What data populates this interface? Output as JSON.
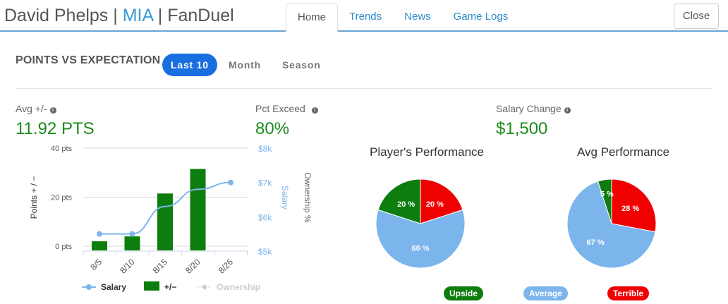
{
  "header": {
    "player": "David Phelps",
    "sep": "|",
    "team": "MIA",
    "site": "FanDuel",
    "tabs": [
      "Home",
      "Trends",
      "News",
      "Game Logs"
    ],
    "close_label": "Close"
  },
  "section": {
    "title": "POINTS VS EXPECTATION",
    "ranges": [
      "Last 10",
      "Month",
      "Season"
    ],
    "active_range": "Last 10"
  },
  "stats": {
    "avg_label": "Avg +/-",
    "avg_value": "11.92 PTS",
    "pct_label": "Pct Exceed",
    "pct_value": "80%",
    "salary_label": "Salary Change",
    "salary_value": "$1,500"
  },
  "colors": {
    "green": "#1e8a1e",
    "bar": "#0d7d0d",
    "salary": "#7cb5ec",
    "red": "#f00000",
    "accent": "#1a6fe0"
  },
  "chart_data": [
    {
      "type": "bar",
      "categories": [
        "8/5",
        "8/10",
        "8/15",
        "8/20",
        "8/26"
      ],
      "series": [
        {
          "name": "+/−",
          "type": "bar",
          "values": [
            2,
            4,
            21.5,
            31.5,
            null
          ]
        },
        {
          "name": "Salary",
          "type": "line",
          "values": [
            5500,
            5500,
            6300,
            6800,
            7000
          ]
        },
        {
          "name": "Ownership",
          "type": "line",
          "values": []
        }
      ],
      "ylabel": "Points + / −",
      "y_ticks": [
        "40 pts",
        "20 pts",
        "0 pts"
      ],
      "ylim": [
        -2,
        40
      ],
      "y2label": "Salary",
      "y2_ticks": [
        "$8k",
        "$7k",
        "$6k",
        "$5k"
      ],
      "y2lim": [
        5000,
        8000
      ],
      "y3label": "Ownership %",
      "legend": [
        "Salary",
        "+/−",
        "Ownership"
      ]
    },
    {
      "type": "pie",
      "title": "Player's Performance",
      "slices": [
        {
          "label": "Upside",
          "value": 20,
          "text": "20 %",
          "color": "#0d7d0d"
        },
        {
          "label": "Terrible",
          "value": 20,
          "text": "20 %",
          "color": "#f00000"
        },
        {
          "label": "Average",
          "value": 60,
          "text": "60 %",
          "color": "#7cb5ec"
        }
      ]
    },
    {
      "type": "pie",
      "title": "Avg Performance",
      "slices": [
        {
          "label": "Upside",
          "value": 5,
          "text": "5 %",
          "color": "#0d7d0d"
        },
        {
          "label": "Terrible",
          "value": 28,
          "text": "28 %",
          "color": "#f00000"
        },
        {
          "label": "Average",
          "value": 67,
          "text": "67 %",
          "color": "#7cb5ec"
        }
      ]
    }
  ],
  "pie_legend": [
    {
      "label": "Upside",
      "color": "#0d7d0d"
    },
    {
      "label": "Average",
      "color": "#7cb5ec"
    },
    {
      "label": "Terrible",
      "color": "#f00000"
    }
  ]
}
